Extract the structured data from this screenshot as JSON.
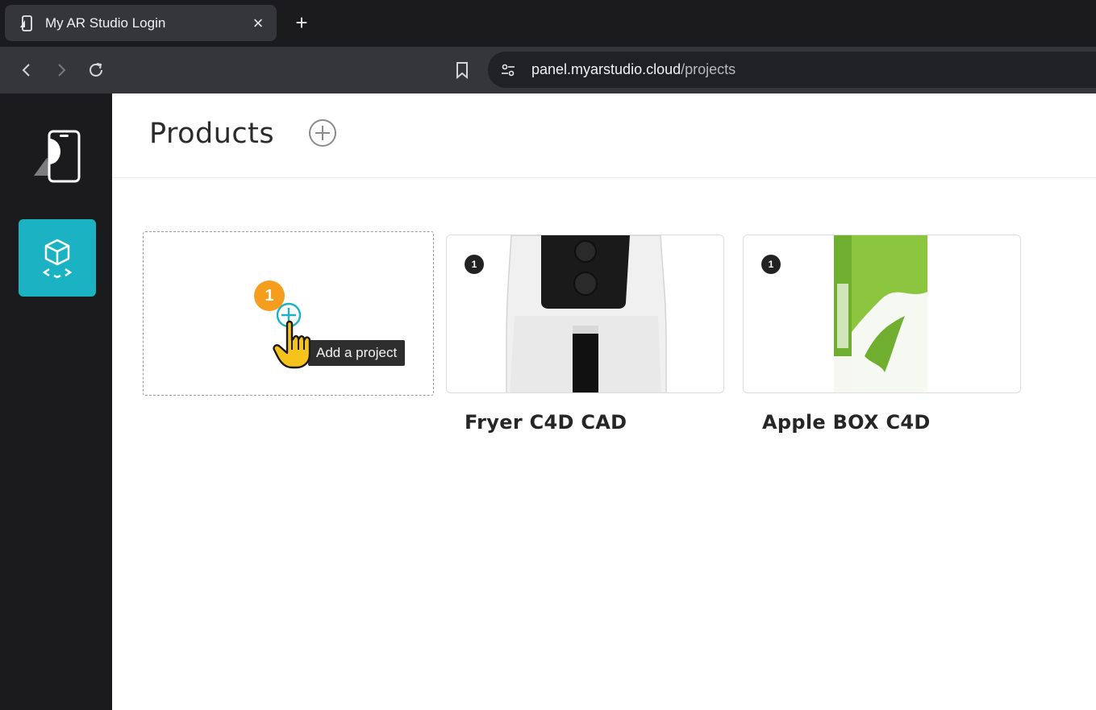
{
  "browser": {
    "tab_title": "My AR Studio Login",
    "tab_close": "×",
    "new_tab": "+",
    "url_host": "panel.myarstudio.cloud",
    "url_path": "/projects"
  },
  "sidebar": {
    "items": [
      {
        "name": "projects",
        "icon": "cube-ar-icon",
        "active": true
      }
    ],
    "accent_color": "#1bb3c4"
  },
  "header": {
    "title": "Products",
    "add_icon": "plus-circle-icon"
  },
  "add_card": {
    "tooltip": "Add a project",
    "step_number": "1",
    "step_color": "#f59d1c"
  },
  "products": [
    {
      "name": "Fryer C4D CAD",
      "count": "1"
    },
    {
      "name": "Apple BOX C4D",
      "count": "1"
    }
  ]
}
